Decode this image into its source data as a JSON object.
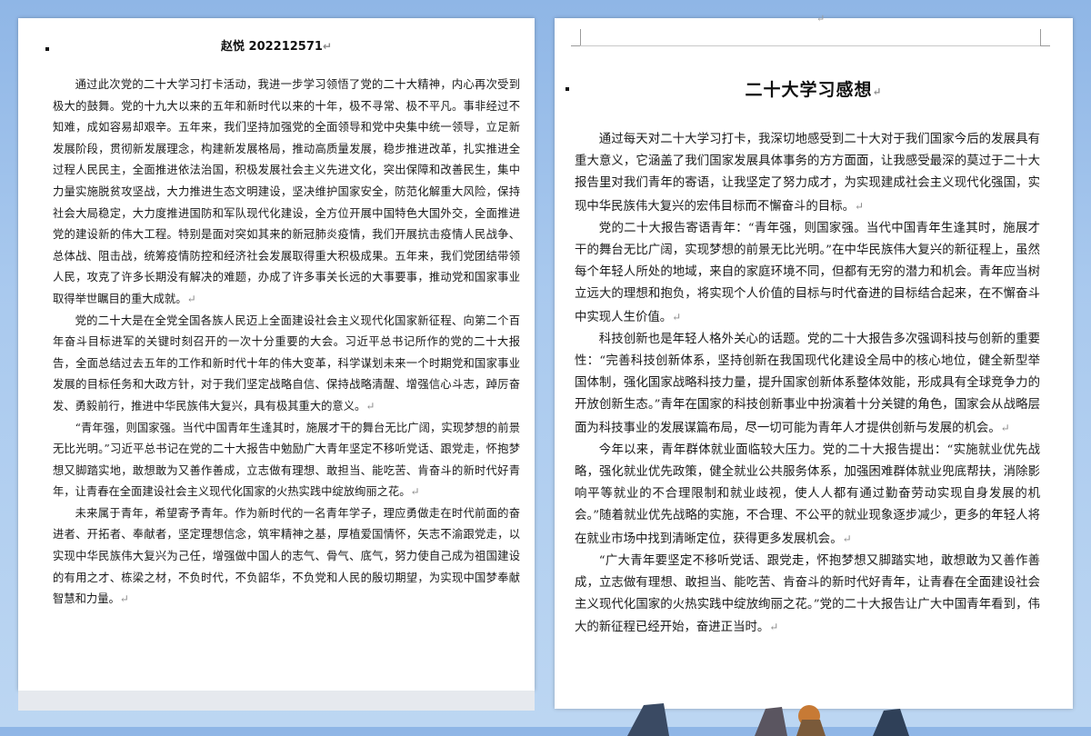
{
  "left_page": {
    "author_line": "赵悦  202212571",
    "paragraphs": [
      "通过此次党的二十大学习打卡活动，我进一步学习领悟了党的二十大精神，内心再次受到极大的鼓舞。党的十九大以来的五年和新时代以来的十年，极不寻常、极不平凡。事非经过不知难，成如容易却艰辛。五年来，我们坚持加强党的全面领导和党中央集中统一领导，立足新发展阶段，贯彻新发展理念，构建新发展格局，推动高质量发展，稳步推进改革，扎实推进全过程人民民主，全面推进依法治国，积极发展社会主义先进文化，突出保障和改善民生，集中力量实施脱贫攻坚战，大力推进生态文明建设，坚决维护国家安全，防范化解重大风险，保持社会大局稳定，大力度推进国防和军队现代化建设，全方位开展中国特色大国外交，全面推进党的建设新的伟大工程。特别是面对突如其来的新冠肺炎疫情，我们开展抗击疫情人民战争、总体战、阻击战，统筹疫情防控和经济社会发展取得重大积极成果。五年来，我们党团结带领人民，攻克了许多长期没有解决的难题，办成了许多事关长远的大事要事，推动党和国家事业取得举世瞩目的重大成就。",
      "党的二十大是在全党全国各族人民迈上全面建设社会主义现代化国家新征程、向第二个百年奋斗目标进军的关键时刻召开的一次十分重要的大会。习近平总书记所作的党的二十大报告，全面总结过去五年的工作和新时代十年的伟大变革，科学谋划未来一个时期党和国家事业发展的目标任务和大政方针，对于我们坚定战略自信、保持战略清醒、增强信心斗志，踔厉奋发、勇毅前行，推进中华民族伟大复兴，具有极其重大的意义。",
      "“青年强，则国家强。当代中国青年生逢其时，施展才干的舞台无比广阔，实现梦想的前景无比光明。”习近平总书记在党的二十大报告中勉励广大青年坚定不移听党话、跟党走，怀抱梦想又脚踏实地，敢想敢为又善作善成，立志做有理想、敢担当、能吃苦、肯奋斗的新时代好青年，让青春在全面建设社会主义现代化国家的火热实践中绽放绚丽之花。",
      "未来属于青年，希望寄予青年。作为新时代的一名青年学子，理应勇做走在时代前面的奋进者、开拓者、奉献者，坚定理想信念，筑牢精神之基，厚植爱国情怀，矢志不渝跟党走，以实现中华民族伟大复兴为己任，增强做中国人的志气、骨气、底气，努力使自己成为祖国建设的有用之才、栋梁之材，不负时代，不负韶华，不负党和人民的殷切期望，为实现中国梦奉献智慧和力量。"
    ]
  },
  "right_page": {
    "title": "二十大学习感想",
    "paragraphs": [
      "通过每天对二十大学习打卡，我深切地感受到二十大对于我们国家今后的发展具有重大意义，它涵盖了我们国家发展具体事务的方方面面，让我感受最深的莫过于二十大报告里对我们青年的寄语，让我坚定了努力成才，为实现建成社会主义现代化强国，实现中华民族伟大复兴的宏伟目标而不懈奋斗的目标。",
      "党的二十大报告寄语青年：“青年强，则国家强。当代中国青年生逢其时，施展才干的舞台无比广阔，实现梦想的前景无比光明。”在中华民族伟大复兴的新征程上，虽然每个年轻人所处的地域，来自的家庭环境不同，但都有无穷的潜力和机会。青年应当树立远大的理想和抱负，将实现个人价值的目标与时代奋进的目标结合起来，在不懈奋斗中实现人生价值。",
      "科技创新也是年轻人格外关心的话题。党的二十大报告多次强调科技与创新的重要性：“完善科技创新体系，坚持创新在我国现代化建设全局中的核心地位，健全新型举国体制，强化国家战略科技力量，提升国家创新体系整体效能，形成具有全球竞争力的开放创新生态。”青年在国家的科技创新事业中扮演着十分关键的角色，国家会从战略层面为科技事业的发展谋篇布局，尽一切可能为青年人才提供创新与发展的机会。",
      "今年以来，青年群体就业面临较大压力。党的二十大报告提出：“实施就业优先战略，强化就业优先政策，健全就业公共服务体系，加强困难群体就业兜底帮扶，消除影响平等就业的不合理限制和就业歧视，使人人都有通过勤奋劳动实现自身发展的机会。”随着就业优先战略的实施，不合理、不公平的就业现象逐步减少，更多的年轻人将在就业市场中找到清晰定位，获得更多发展机会。",
      "“广大青年要坚定不移听党话、跟党走，怀抱梦想又脚踏实地，敢想敢为又善作善成，立志做有理想、敢担当、能吃苦、肯奋斗的新时代好青年，让青春在全面建设社会主义现代化国家的火热实践中绽放绚丽之花。”党的二十大报告让广大中国青年看到，伟大的新征程已经开始，奋进正当时。"
    ]
  },
  "paragraph_mark": "↵",
  "colors": {
    "background": "#a9c9ee",
    "page": "#ffffff",
    "text": "#1a1a1a"
  }
}
